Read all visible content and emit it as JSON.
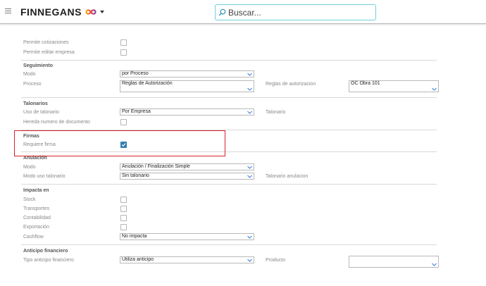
{
  "header": {
    "brand": "FINNEGANS",
    "search_placeholder": "Buscar..."
  },
  "top_fields": {
    "permite_cotizaciones": {
      "label": "Permite cotizaciones",
      "checked": false
    },
    "permite_editar_empresa": {
      "label": "Permite editar empresa",
      "checked": false
    }
  },
  "seguimiento": {
    "title": "Seguimiento",
    "modo": {
      "label": "Modo",
      "value": "por Proceso"
    },
    "proceso": {
      "label": "Proceso",
      "value": "Reglas de Autorización"
    },
    "reglas": {
      "label": "Reglas de autorizacion",
      "value": "OC Obra 101"
    }
  },
  "talonarios": {
    "title": "Talonarios",
    "uso": {
      "label": "Uso de talonario",
      "value": "Por Empresa"
    },
    "talonario": {
      "label": "Talonario"
    },
    "hereda": {
      "label": "Hereda numero de documento",
      "checked": false
    }
  },
  "firmas": {
    "title": "Firmas",
    "requiere": {
      "label": "Requiere firma",
      "checked": true
    }
  },
  "anulacion": {
    "title": "Anulación",
    "modo": {
      "label": "Modo",
      "value": "Anulación / Finalización Simple"
    },
    "modo_uso": {
      "label": "Modo uso talonario",
      "value": "Sin talonario"
    },
    "talonario_anulacion": {
      "label": "Talonario anulacion"
    }
  },
  "impacta": {
    "title": "Impacta en",
    "stock": {
      "label": "Stock",
      "checked": false
    },
    "transportes": {
      "label": "Transportes",
      "checked": false
    },
    "contabilidad": {
      "label": "Contabilidad",
      "checked": false
    },
    "exportacion": {
      "label": "Exportación",
      "checked": false
    },
    "cashflow": {
      "label": "Cashflow",
      "value": "No impacta"
    }
  },
  "anticipo": {
    "title": "Anticipo financiero",
    "tipo": {
      "label": "Tipo anticipo financiero",
      "value": "Utiliza anticipo"
    },
    "producto": {
      "label": "Producto",
      "value": ""
    }
  },
  "colors": {
    "accent": "#2f7fb1",
    "search_border": "#6fd0d9",
    "highlight": "#d6232b"
  }
}
